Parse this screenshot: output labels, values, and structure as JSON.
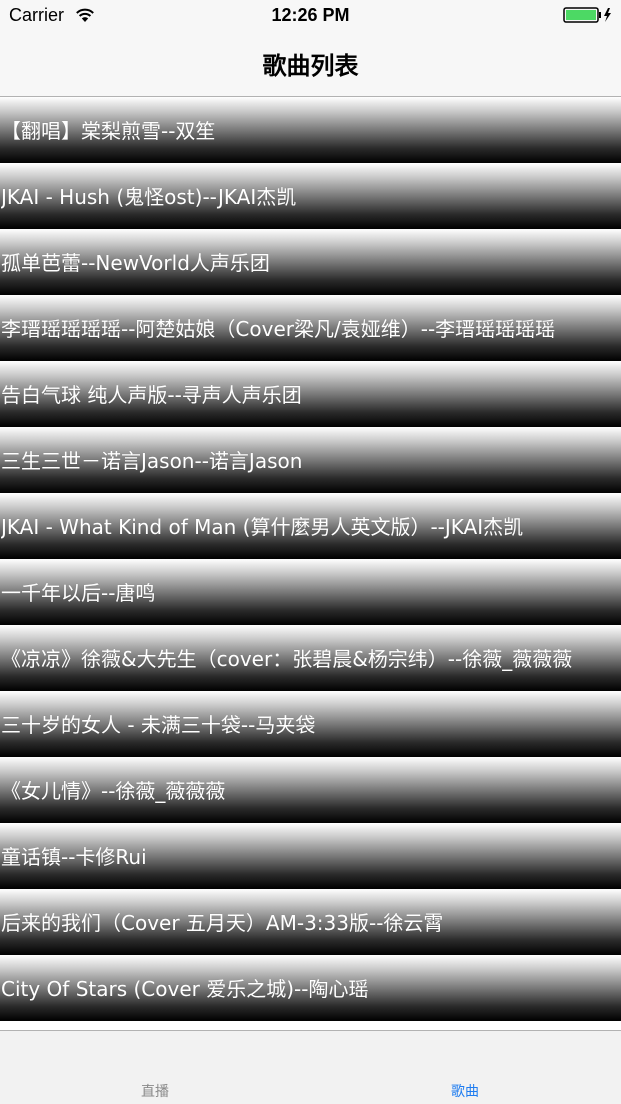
{
  "status_bar": {
    "carrier": "Carrier",
    "time": "12:26 PM",
    "wifi_icon": "wifi-icon",
    "battery_icon": "battery-icon",
    "battery_color": "#4cd964"
  },
  "nav": {
    "title": "歌曲列表"
  },
  "songs": [
    {
      "label": "【翻唱】棠梨煎雪--双笙"
    },
    {
      "label": "JKAI - Hush (鬼怪ost)--JKAI杰凯"
    },
    {
      "label": "孤单芭蕾--NewVorld人声乐团"
    },
    {
      "label": "李瑨瑶瑶瑶瑶--阿楚姑娘（Cover梁凡/袁娅维）--李瑨瑶瑶瑶瑶"
    },
    {
      "label": "告白气球 纯人声版--寻声人声乐团"
    },
    {
      "label": "三生三世－诺言Jason--诺言Jason"
    },
    {
      "label": "JKAI - What Kind of Man (算什麼男人英文版）--JKAI杰凯"
    },
    {
      "label": "一千年以后--唐鸣"
    },
    {
      "label": "《凉凉》徐薇&大先生（cover：张碧晨&杨宗纬）--徐薇_薇薇薇"
    },
    {
      "label": "三十岁的女人 - 未满三十袋--马夹袋"
    },
    {
      "label": "《女儿情》--徐薇_薇薇薇"
    },
    {
      "label": "童话镇--卡修Rui"
    },
    {
      "label": "后来的我们（Cover 五月天）AM-3:33版--徐云霄"
    },
    {
      "label": "City Of Stars (Cover 爱乐之城)--陶心瑶"
    }
  ],
  "tab_bar": {
    "tabs": [
      {
        "label": "直播",
        "selected": false
      },
      {
        "label": "歌曲",
        "selected": true
      }
    ],
    "selected_color": "#1e7cf0",
    "unselected_color": "#8a8a8a"
  }
}
